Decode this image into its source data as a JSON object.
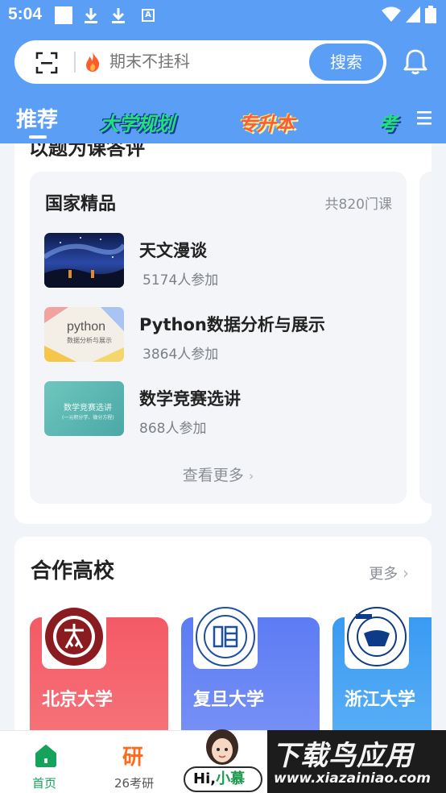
{
  "status": {
    "time": "5:04"
  },
  "search": {
    "placeholder": "期末不挂科",
    "button": "搜索"
  },
  "tabs": [
    {
      "label": "推荐",
      "active": true
    },
    {
      "label": "大学规划"
    },
    {
      "label": "专升本"
    },
    {
      "label": "考"
    }
  ],
  "section_peek_title": "以题为课答评",
  "national": {
    "title": "国家精品",
    "count": "共820门课",
    "courses": [
      {
        "title": "天文漫谈",
        "participants": "5174人参加",
        "thumb_text": ""
      },
      {
        "title": "Python数据分析与展示",
        "participants": "3864人参加",
        "thumb_text": "python",
        "thumb_sub": "数据分析与展示"
      },
      {
        "title": "数学竞赛选讲",
        "participants": "868人参加",
        "thumb_text": "数学竞赛选讲",
        "thumb_sub": "(一元积分学、微分方程)"
      }
    ],
    "more": "查看更多"
  },
  "partners": {
    "title": "合作高校",
    "more": "更多",
    "schools": [
      {
        "name": "北京大学",
        "color": "#f45a66"
      },
      {
        "name": "复旦大学",
        "color": "#5c7cf4"
      },
      {
        "name": "浙江大学",
        "color": "#3a9af2"
      }
    ]
  },
  "bottom_nav": {
    "home": "首页",
    "yan_glyph": "研",
    "yan": "26考研",
    "hi": "Hi,",
    "hi_name": "小慕"
  },
  "watermark": {
    "cn": "下载鸟应用",
    "url": "www.xiazainiao.com"
  },
  "colors": {
    "primary": "#5b9ef6",
    "home_green": "#15a35c",
    "yan_orange": "#ff6b1a"
  }
}
